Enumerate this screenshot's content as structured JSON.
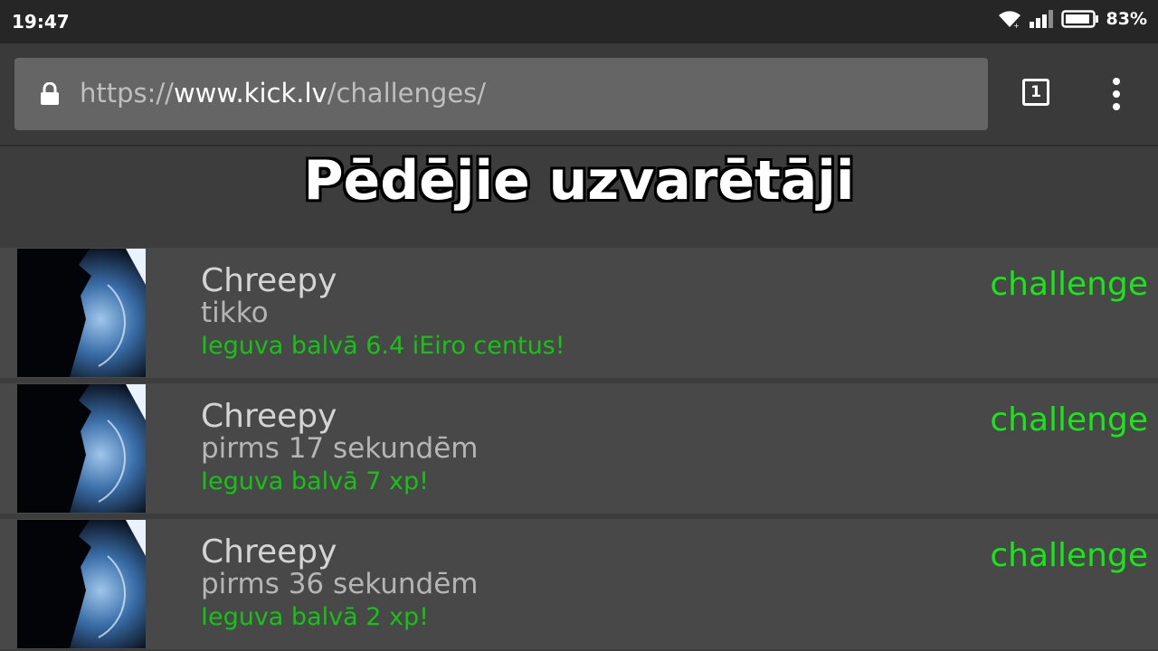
{
  "status_bar": {
    "time": "19:47",
    "battery": "83%",
    "icons": [
      "wifi-icon",
      "signal-icon",
      "battery-icon"
    ]
  },
  "browser": {
    "url_scheme": "https://",
    "url_host": "www.kick.lv",
    "url_path": "/challenges/",
    "tab_count": "1",
    "icons": [
      "lock-icon",
      "tabs-icon",
      "overflow-menu-icon"
    ]
  },
  "page": {
    "title": "Pēdējie uzvarētāji"
  },
  "winners": [
    {
      "name": "Chreepy",
      "time": "tikko",
      "prize": "Ieguva balvā 6.4 iEiro centus!",
      "link": "challenge"
    },
    {
      "name": "Chreepy",
      "time": "pirms 17 sekundēm",
      "prize": "Ieguva balvā 7 xp!",
      "link": "challenge"
    },
    {
      "name": "Chreepy",
      "time": "pirms 36 sekundēm",
      "prize": "Ieguva balvā 2 xp!",
      "link": "challenge"
    }
  ],
  "colors": {
    "prize_green": "#17c217",
    "link_green": "#19e619",
    "row_bg": "#484848",
    "page_bg": "#3d3d3d"
  }
}
